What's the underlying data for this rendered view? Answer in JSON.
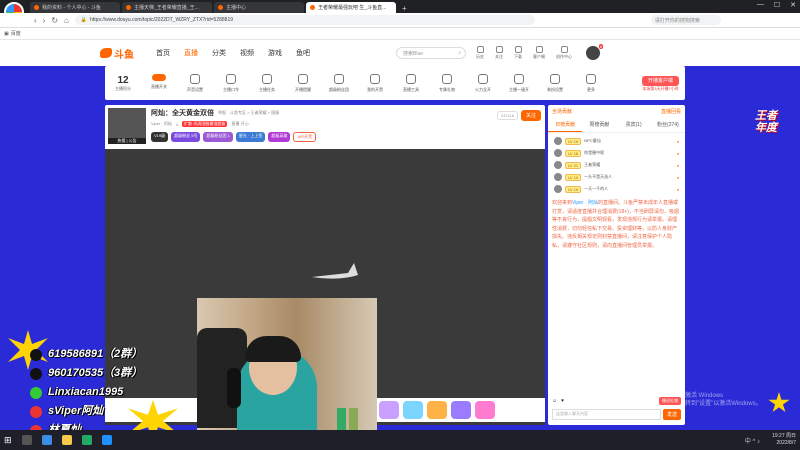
{
  "browser": {
    "logo_text": "百里斗鱼",
    "tabs": [
      {
        "label": "我的资料 - 个人中心 - 斗鱼"
      },
      {
        "label": "主播天梯_王者荣耀直播_王..."
      },
      {
        "label": "主播中心"
      },
      {
        "label": "王者荣耀最强玩吧 生_斗鱼直..."
      }
    ],
    "new_tab": "+",
    "window_controls": [
      "—",
      "☐",
      "✕"
    ],
    "url": "https://www.douyu.com/topic/2022DT_WZRY_ZTX?rid=5288819",
    "search_placeholder": "请打开你的搜狗搜索",
    "bookmark": "百度"
  },
  "douyu_header": {
    "logo": "斗鱼",
    "nav": [
      "首页",
      "直播",
      "分类",
      "视频",
      "游戏",
      "鱼吧"
    ],
    "search_placeholder": "搜索Blue",
    "icons": [
      "历史",
      "关注",
      "下载",
      "客户端",
      "创作中心"
    ],
    "avatar_badge": "8"
  },
  "toolrow": {
    "first_value": "12",
    "first_label": "主播积分",
    "items": [
      "直播开关",
      "声音设置",
      "主播口令",
      "主播任务",
      "开播提醒",
      "超级粉丝团",
      "我的开黑",
      "直播工具",
      "专属礼物",
      "火力全开",
      "主播一键开",
      "装扮设置",
      "更多"
    ],
    "right_button": "开播客户端",
    "right_sub": "本场第3天开播7小时"
  },
  "room": {
    "avatar_label": "热搜 | 公告",
    "title": "阿灿：全天黄金双倍",
    "sub_title": "举报",
    "meta_1": "斗鱼专区 > 王者荣耀 > 国服",
    "meta_owner": "Viper · 阿灿",
    "meta_level": "4",
    "meta_tag": "扩散·风雨国服最强超级",
    "meta_tag2": "直播·开心",
    "badges": [
      "V19级",
      "超级粉丝 5号",
      "超级粉丝团 1",
      "星光 · 上上签",
      "超级英雄"
    ],
    "badge_extra": "AIR开黑",
    "follow_count": "237116",
    "follow_label": "关注"
  },
  "side": {
    "top_left": "全场贡献",
    "top_right": "直播回看",
    "tabs": [
      "日榜贡献",
      "周榜贡献",
      "贵宾(1)",
      "粉丝(274)"
    ],
    "ranks": [
      {
        "lv": "LV 19",
        "name": "NPC傻仙"
      },
      {
        "lv": "LV 18",
        "name": "你是圈中呢"
      },
      {
        "lv": "LV 21",
        "name": "王者荣耀"
      },
      {
        "lv": "LV 19",
        "name": "一头不是天选人"
      },
      {
        "lv": "LV 19",
        "name": "一天一千的人"
      }
    ],
    "notice_prefix": "欢迎来到",
    "notice_name": "Viper · 阿灿",
    "notice_body": "的直播间。斗鱼严禁未成年人直播或打赏，请适度直播并合理消费(18+)，不当刷屏请勿，吸烟等不良行为，提倡文明观看，发现违规行为请举报。请理性消费，切勿轻信私下交易、投资理财等，以防人身财产损失。违反相关规定则封禁直播间，请注意保护个人隐私，请遵守社区规则，请向直播间管理员举报。",
    "chat_placeholder": "这里输入聊天内容",
    "send_label": "发送",
    "gift_btn": "赠送礼物"
  },
  "overlay": {
    "lines": [
      "619586891（2群）",
      "960170535（3群）",
      "Linxiacan1995",
      "sViper阿灿",
      "林夏灿"
    ],
    "event_badge": "王者\n年度"
  },
  "watermark": {
    "line1": "激活 Windows",
    "line2": "转到\"设置\"以激活Windows。"
  },
  "taskbar": {
    "tray": "中 ^ ♪",
    "time": "19:27 周日",
    "date": "2022/8/7"
  },
  "colors": {
    "accent": "#ff6600",
    "background": "#2a2bd6",
    "overlay_yellow": "#ffd400"
  }
}
